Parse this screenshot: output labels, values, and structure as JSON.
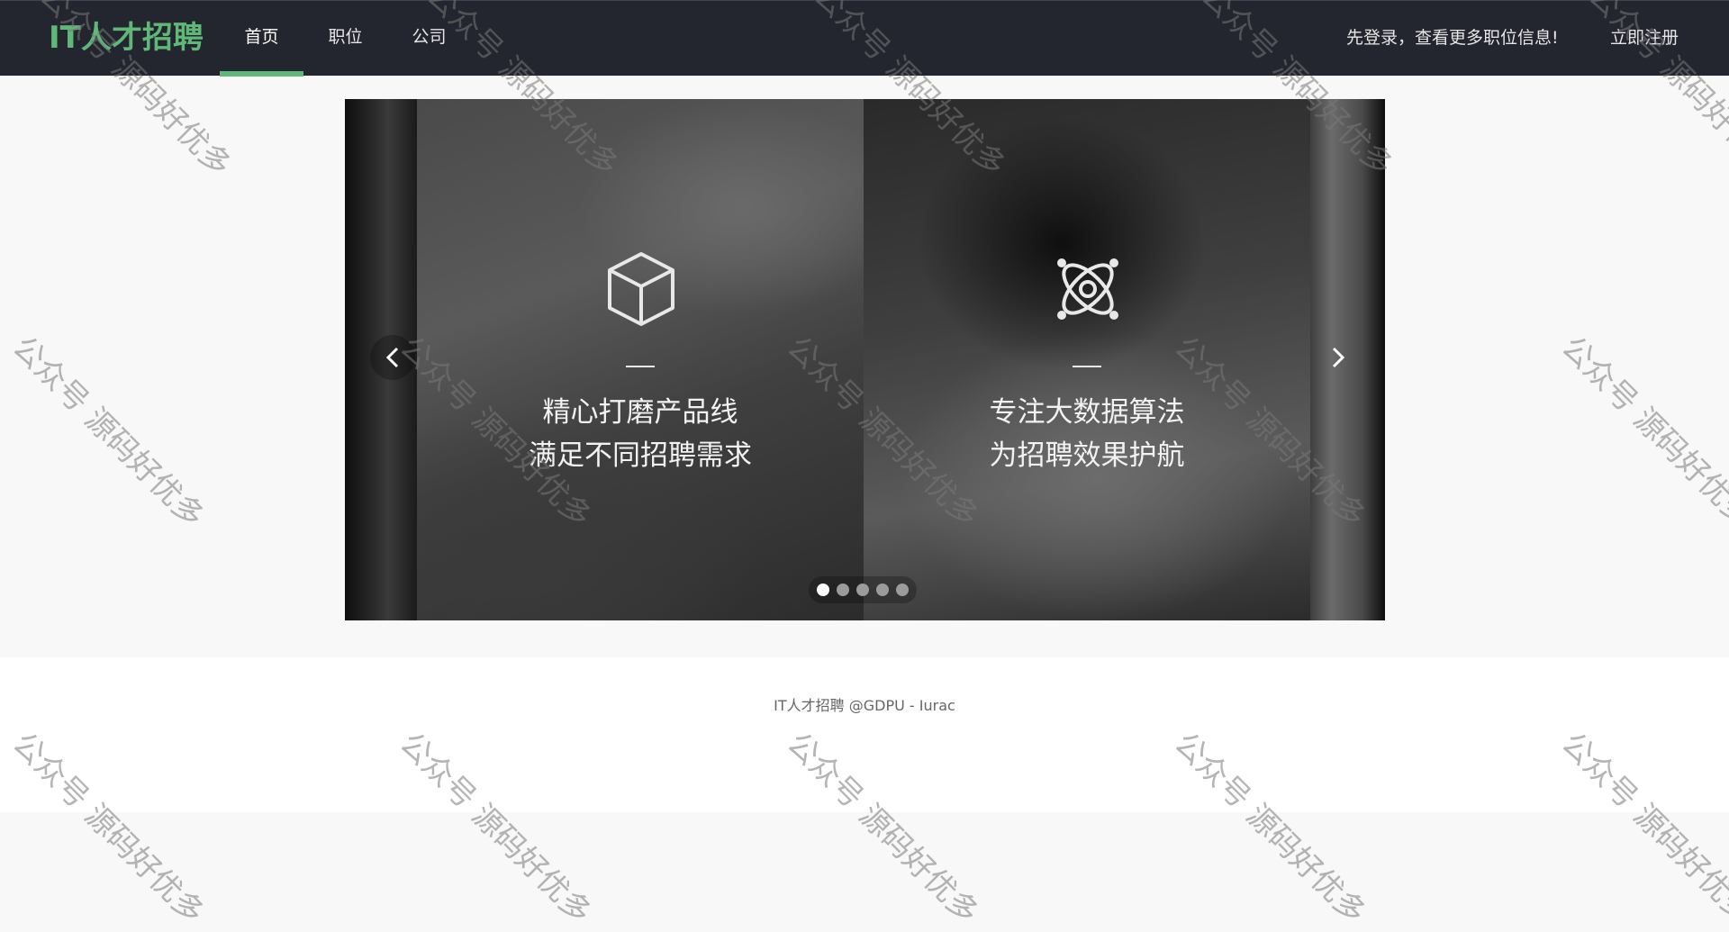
{
  "header": {
    "logo": "IT人才招聘",
    "nav": [
      {
        "label": "首页",
        "active": true
      },
      {
        "label": "职位",
        "active": false
      },
      {
        "label": "公司",
        "active": false
      }
    ],
    "login_hint": "先登录，查看更多职位信息!",
    "register": "立即注册"
  },
  "carousel": {
    "slides": [
      {
        "icon": "cube-icon",
        "line1": "精心打磨产品线",
        "line2": "满足不同招聘需求"
      },
      {
        "icon": "atom-icon",
        "line1": "专注大数据算法",
        "line2": "为招聘效果护航"
      }
    ],
    "indicator_count": 5,
    "active_indicator": 0,
    "prev_icon": "chevron-left-icon",
    "next_icon": "chevron-right-icon"
  },
  "footer": {
    "text": "IT人才招聘 @GDPU - Iurac"
  },
  "watermark": {
    "text": "公众号 源码好优多"
  },
  "colors": {
    "header_bg": "#23262e",
    "accent": "#5fb878",
    "page_bg": "#f8f8f8"
  }
}
